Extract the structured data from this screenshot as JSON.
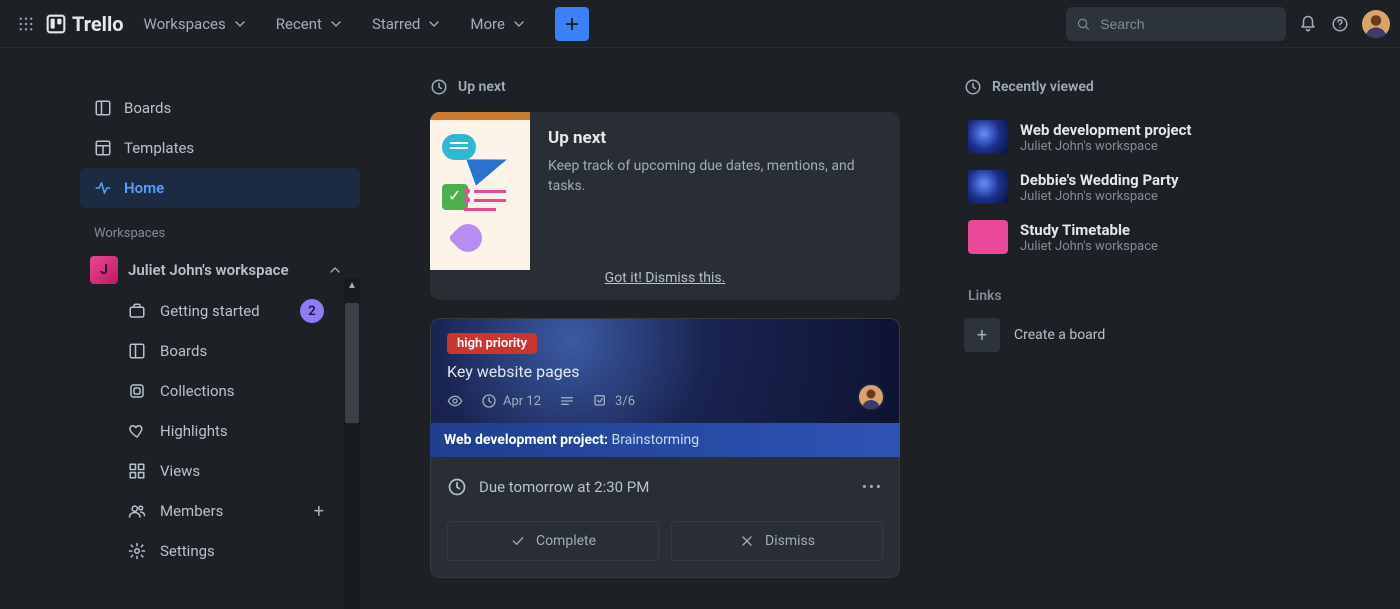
{
  "brand": "Trello",
  "topnav": {
    "workspaces": "Workspaces",
    "recent": "Recent",
    "starred": "Starred",
    "more": "More"
  },
  "search": {
    "placeholder": "Search"
  },
  "sidebar": {
    "boards": "Boards",
    "templates": "Templates",
    "home": "Home",
    "section_label": "Workspaces",
    "workspace": {
      "initial": "J",
      "name": "Juliet John's workspace"
    },
    "items": {
      "getting_started": "Getting started",
      "getting_started_badge": "2",
      "boards": "Boards",
      "collections": "Collections",
      "highlights": "Highlights",
      "views": "Views",
      "members": "Members",
      "settings": "Settings"
    }
  },
  "upnext": {
    "section": "Up next",
    "title": "Up next",
    "body": "Keep track of upcoming due dates, mentions, and tasks.",
    "dismiss": "Got it! Dismiss this."
  },
  "card": {
    "label": "high priority",
    "title": "Key website pages",
    "date": "Apr 12",
    "checklist": "3/6",
    "project": "Web development project:",
    "list": "Brainstorming",
    "due": "Due tomorrow at 2:30 PM",
    "complete": "Complete",
    "dismiss": "Dismiss"
  },
  "right": {
    "section": "Recently viewed",
    "items": [
      {
        "title": "Web development project",
        "sub": "Juliet John's workspace"
      },
      {
        "title": "Debbie's Wedding Party",
        "sub": "Juliet John's workspace"
      },
      {
        "title": "Study Timetable",
        "sub": "Juliet John's workspace"
      }
    ],
    "links": "Links",
    "create": "Create a board"
  }
}
